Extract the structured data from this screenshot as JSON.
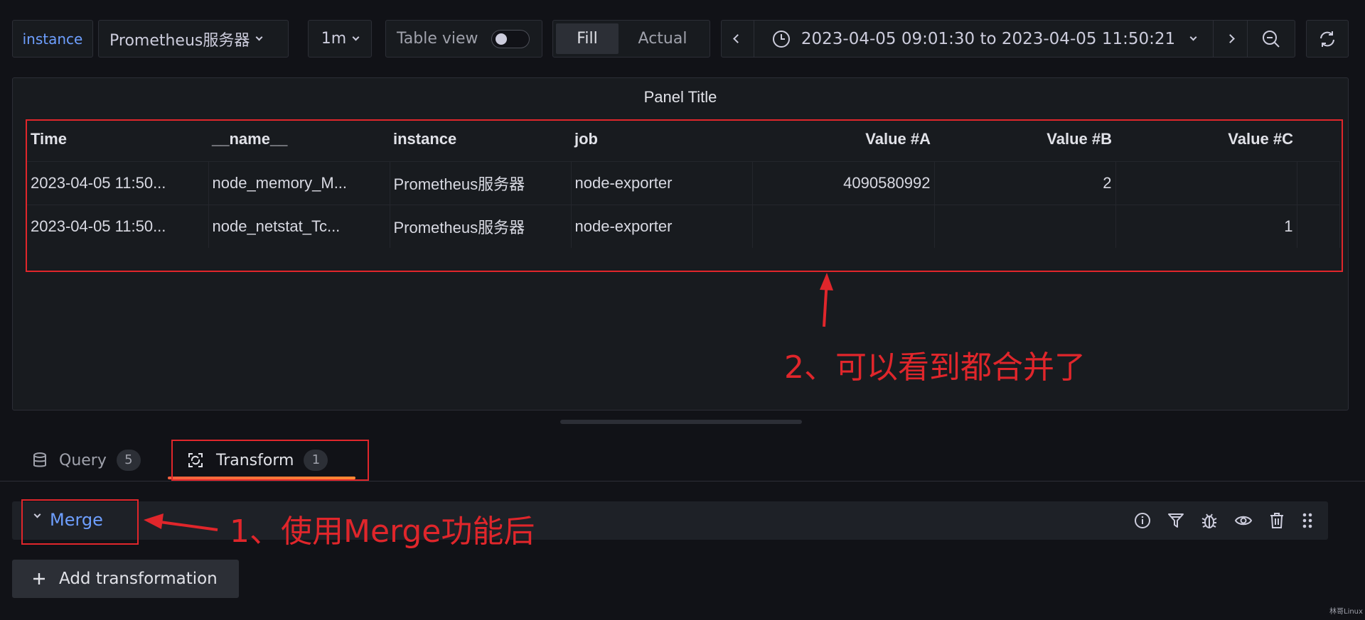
{
  "toolbar": {
    "variable_label": "instance",
    "variable_value": "Prometheus服务器",
    "interval": "1m",
    "table_view_label": "Table view",
    "fill_label": "Fill",
    "actual_label": "Actual",
    "time_range": "2023-04-05 09:01:30 to 2023-04-05 11:50:21"
  },
  "panel": {
    "title": "Panel Title",
    "columns": [
      "Time",
      "__name__",
      "instance",
      "job",
      "Value #A",
      "Value #B",
      "Value #C"
    ],
    "rows": [
      [
        "2023-04-05 11:50...",
        "node_memory_M...",
        "Prometheus服务器",
        "node-exporter",
        "4090580992",
        "2",
        ""
      ],
      [
        "2023-04-05 11:50...",
        "node_netstat_Tc...",
        "Prometheus服务器",
        "node-exporter",
        "",
        "",
        "1"
      ]
    ]
  },
  "tabs": {
    "query_label": "Query",
    "query_count": "5",
    "transform_label": "Transform",
    "transform_count": "1"
  },
  "transform": {
    "merge_label": "Merge",
    "add_label": "Add transformation"
  },
  "annotations": {
    "note_1": "1、使用Merge功能后",
    "note_2": "2、可以看到都合并了",
    "color": "#e0262b"
  },
  "watermark": "林哥Linux",
  "colors": {
    "background": "#111217",
    "panel": "#181b1f",
    "link_blue": "#6e9fff",
    "tab_underline": "#ff8833"
  }
}
